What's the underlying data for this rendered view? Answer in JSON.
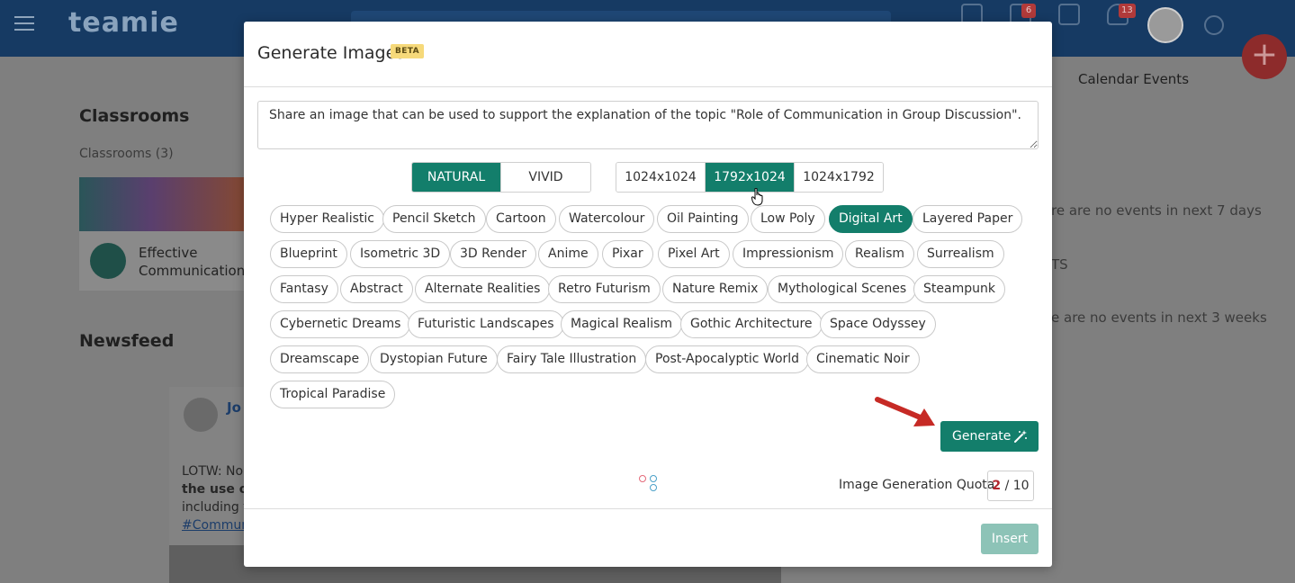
{
  "background": {
    "logo": "teamie",
    "badges": {
      "messages": "6",
      "notifications": "13"
    },
    "classrooms_heading": "Classrooms",
    "classrooms_count": "Classrooms (3)",
    "class_title": "Effective Communication",
    "newsfeed_heading": "Newsfeed",
    "post_name": "Jo",
    "post_lines": [
      "LOTW: Nor",
      "the use of",
      "including t",
      "#Commun"
    ],
    "calendar_heading": "Calendar Events",
    "events_week": "re are no events in next 7 days",
    "events_ts": "TS",
    "events_weeks": "e are no events in next 3 weeks"
  },
  "modal": {
    "title": "Generate Images",
    "beta": "BETA",
    "prompt": "Share an image that can be used to support the explanation of the topic \"Role of Communication in Group Discussion\".",
    "style_modes": [
      {
        "label": "NATURAL",
        "active": true
      },
      {
        "label": "VIVID",
        "active": false
      }
    ],
    "sizes": [
      {
        "label": "1024x1024",
        "active": false
      },
      {
        "label": "1792x1024",
        "active": true
      },
      {
        "label": "1024x1792",
        "active": false
      }
    ],
    "styles": [
      [
        "Hyper Realistic",
        "Pencil Sketch",
        "Cartoon",
        "Watercolour",
        "Oil Painting",
        "Low Poly",
        "Digital Art",
        "Layered Paper"
      ],
      [
        "Blueprint",
        "Isometric 3D",
        "3D Render",
        "Anime",
        "Pixar",
        "Pixel Art",
        "Impressionism",
        "Realism",
        "Surrealism"
      ],
      [
        "Fantasy",
        "Abstract",
        "Alternate Realities",
        "Retro Futurism",
        "Nature Remix",
        "Mythological Scenes",
        "Steampunk"
      ],
      [
        "Cybernetic Dreams",
        "Futuristic Landscapes",
        "Magical Realism",
        "Gothic Architecture",
        "Space Odyssey"
      ],
      [
        "Dreamscape",
        "Dystopian Future",
        "Fairy Tale Illustration",
        "Post-Apocalyptic World",
        "Cinematic Noir"
      ],
      [
        "Tropical Paradise"
      ]
    ],
    "active_style": "Digital Art",
    "generate_label": "Generate",
    "quota_label": "Image Generation Quota",
    "quota_used": "2",
    "quota_total": "/ 10",
    "insert_label": "Insert"
  },
  "colors": {
    "accent": "#137e6b",
    "arrow": "#c62a25",
    "quota_used": "#b1262d"
  }
}
